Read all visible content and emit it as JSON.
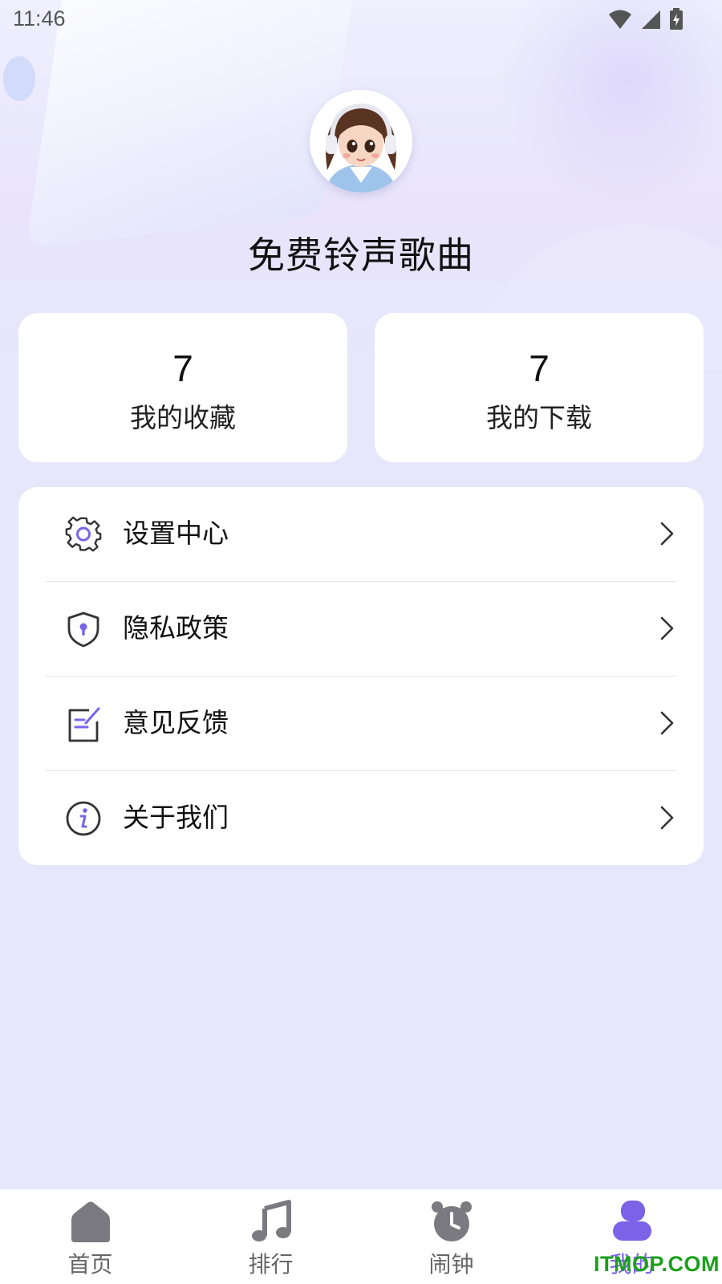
{
  "status_bar": {
    "time": "11:46",
    "icons": [
      "wifi-icon",
      "cellular-signal-icon",
      "battery-charging-icon"
    ]
  },
  "profile": {
    "avatar_icon": "girl-with-headphones-avatar",
    "app_name": "免费铃声歌曲"
  },
  "stats": [
    {
      "count": "7",
      "label": "我的收藏"
    },
    {
      "count": "7",
      "label": "我的下载"
    }
  ],
  "menu": {
    "items": [
      {
        "label": "设置中心",
        "icon": "gear-icon"
      },
      {
        "label": "隐私政策",
        "icon": "shield-lock-icon"
      },
      {
        "label": "意见反馈",
        "icon": "edit-note-icon"
      },
      {
        "label": "关于我们",
        "icon": "info-icon"
      }
    ]
  },
  "tabs": [
    {
      "label": "首页",
      "icon": "home-icon",
      "active": false
    },
    {
      "label": "排行",
      "icon": "music-note-icon",
      "active": false
    },
    {
      "label": "闹钟",
      "icon": "alarm-clock-icon",
      "active": false
    },
    {
      "label": "我的",
      "icon": "user-icon",
      "active": true
    }
  ],
  "watermark": "ITMOP.COM",
  "colors": {
    "accent": "#7b63e8",
    "background": "#e6e7fb",
    "card": "#ffffff",
    "tab_inactive": "#7a7a80",
    "watermark": "#1aa01a"
  }
}
